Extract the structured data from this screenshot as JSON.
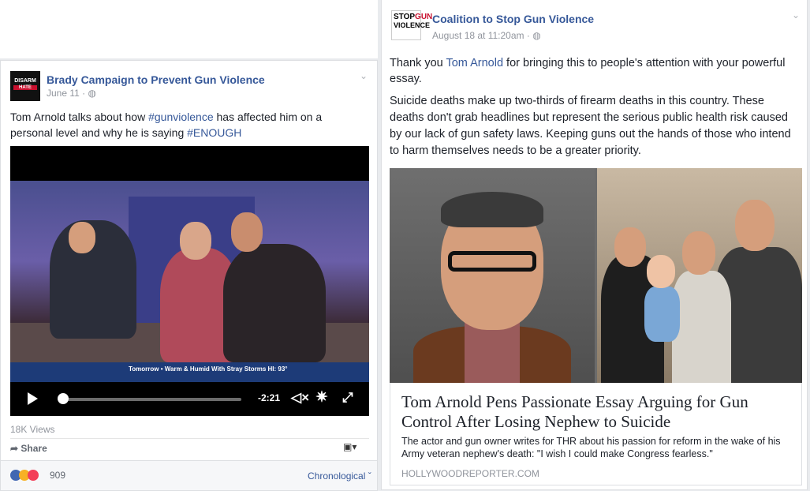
{
  "left_post": {
    "page_name": "Brady Campaign to Prevent Gun Violence",
    "avatar_text_top": "DISARM",
    "avatar_text_bar": "HATE",
    "date": "June 11",
    "text_before": "Tom Arnold talks about how ",
    "hashtag1": "#gunviolence",
    "text_middle": " has affected him on a personal level and why he is saying ",
    "hashtag2": "#ENOUGH",
    "video": {
      "ticker_text": "Tomorrow • Warm & Humid With Stray Storms  HI: 93°",
      "time_remaining": "-2:21",
      "progress": 0.03
    },
    "views": "18K Views",
    "share_label": "Share",
    "reaction_count": "909",
    "sort_label": "Chronological ˇ"
  },
  "right_post": {
    "page_name": "Coalition to Stop Gun Violence",
    "avatar_line1": "STOP",
    "avatar_line1_accent": "GUN",
    "avatar_line2": "VIOLENCE",
    "date": "August 18 at 11:20am",
    "para1_before": "Thank you ",
    "para1_link": "Tom Arnold",
    "para1_after": " for bringing this to people's attention with your powerful essay.",
    "para2": "Suicide deaths make up two-thirds of firearm deaths in this country. These deaths don't grab headlines but represent the serious public health risk caused by our lack of gun safety laws. Keeping guns out the hands of those who intend to harm themselves needs to be a greater priority.",
    "link_title": "Tom Arnold Pens Passionate Essay Arguing for Gun Control After Losing Nephew to Suicide",
    "link_desc": "The actor and gun owner writes for THR about his passion for reform in the wake of his Army veteran nephew's death: \"I wish I could make Congress fearless.\"",
    "link_domain": "HOLLYWOODREPORTER.COM"
  },
  "colors": {
    "link": "#365899",
    "meta": "#90949c",
    "brand_red": "#c8102e"
  }
}
